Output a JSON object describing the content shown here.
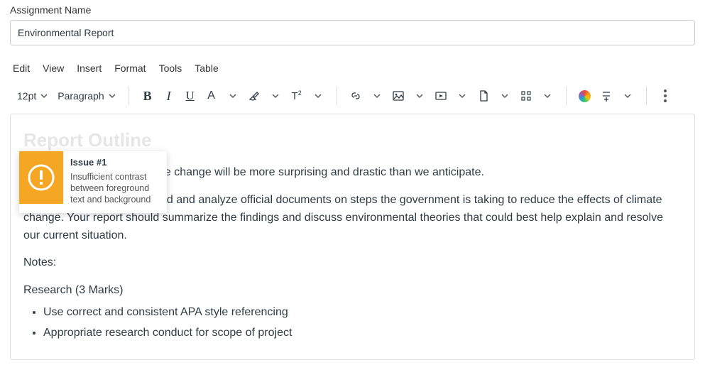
{
  "assignment": {
    "label": "Assignment Name",
    "value": "Environmental Report"
  },
  "menu": {
    "edit": "Edit",
    "view": "View",
    "insert": "Insert",
    "format": "Format",
    "tools": "Tools",
    "table": "Table"
  },
  "toolbar": {
    "font_size": "12pt",
    "paragraph": "Paragraph",
    "superscript_label": "T²"
  },
  "content": {
    "heading": "Report Outline",
    "thesis": "Thesis: The results of climate change will be more surprising and drastic than we anticipate.",
    "task": "Task: Your task will be to read and analyze official documents on steps the government is taking to reduce the effects of climate change. Your report should summarize the findings and discuss environmental theories that could best help explain and resolve our current situation.",
    "notes": "Notes:",
    "research": "Research (3 Marks)",
    "bullets": [
      "Use correct and consistent APA style referencing",
      "Appropriate research conduct for scope of project"
    ]
  },
  "a11y": {
    "title": "Issue #1",
    "body": "Insufficient contrast between foreground text and background"
  }
}
